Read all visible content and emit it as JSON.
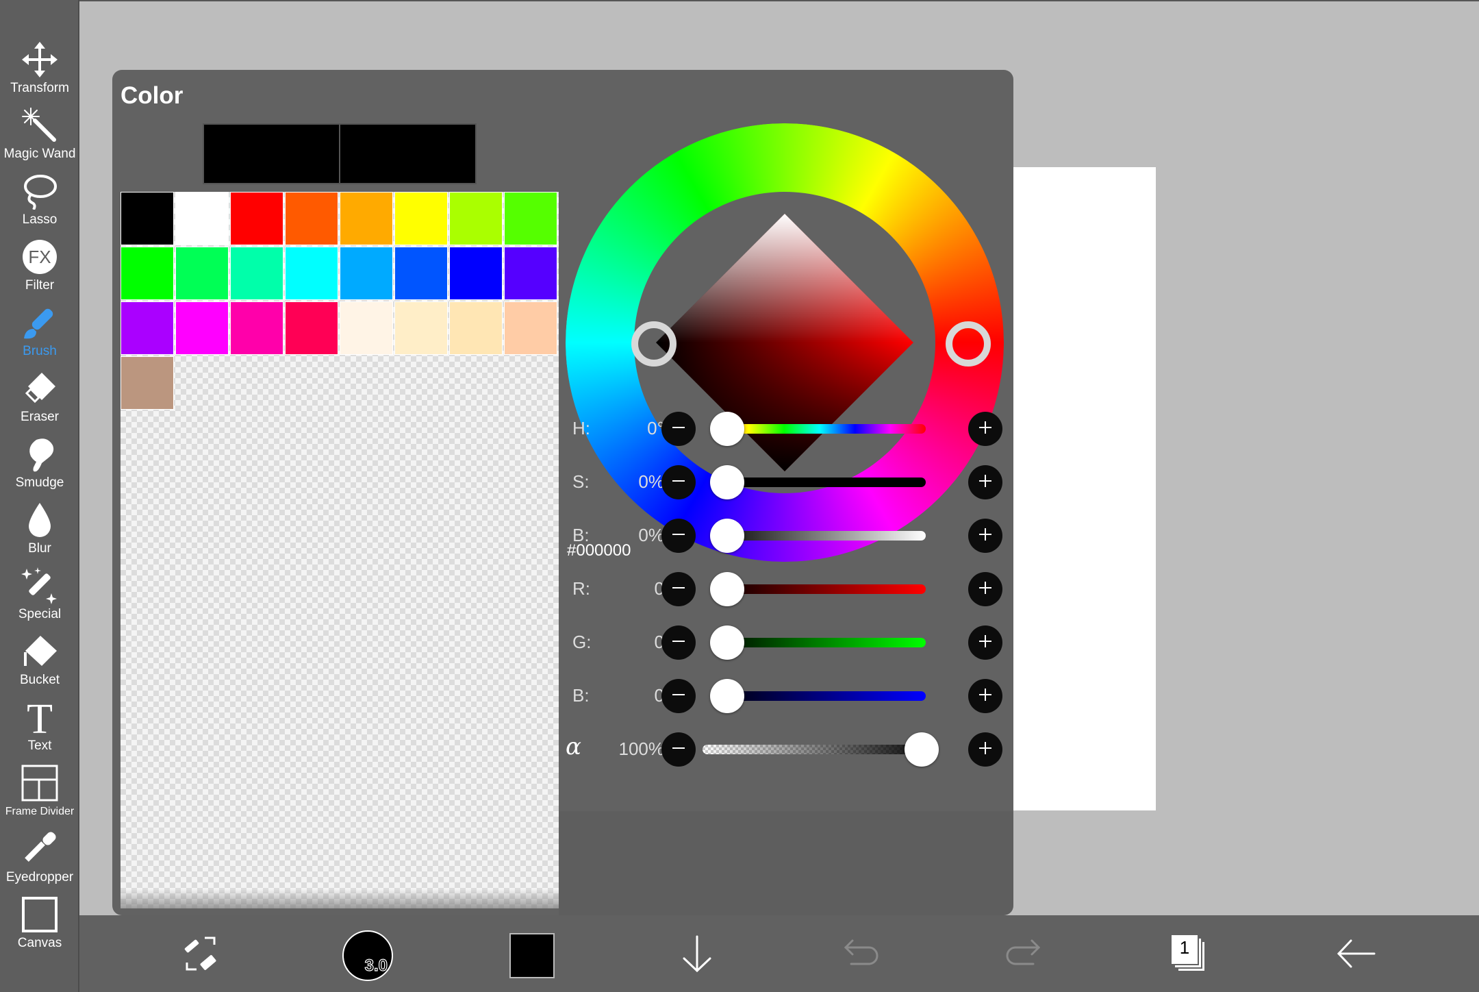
{
  "toolbar": {
    "items": [
      {
        "label": "Transform",
        "icon": "move-arrows-icon"
      },
      {
        "label": "Magic Wand",
        "icon": "magic-wand-icon"
      },
      {
        "label": "Lasso",
        "icon": "lasso-icon"
      },
      {
        "label": "Filter",
        "icon": "fx-icon"
      },
      {
        "label": "Brush",
        "icon": "brush-icon",
        "active": true
      },
      {
        "label": "Eraser",
        "icon": "eraser-icon"
      },
      {
        "label": "Smudge",
        "icon": "smudge-finger-icon"
      },
      {
        "label": "Blur",
        "icon": "droplet-icon"
      },
      {
        "label": "Special",
        "icon": "sparkle-pen-icon"
      },
      {
        "label": "Bucket",
        "icon": "bucket-icon"
      },
      {
        "label": "Text",
        "icon": "text-t-icon"
      },
      {
        "label": "Frame Divider",
        "icon": "frame-divider-icon"
      },
      {
        "label": "Eyedropper",
        "icon": "eyedropper-icon"
      },
      {
        "label": "Canvas",
        "icon": "canvas-square-icon"
      }
    ],
    "active_color": "#3b9af0"
  },
  "color_panel": {
    "title": "Color",
    "current_color": "#000000",
    "previous_color": "#000000",
    "hex": "#000000",
    "palette": [
      "#000000",
      "#ffffff",
      "#ff0000",
      "#ff5a00",
      "#ffaa00",
      "#ffff00",
      "#aaff00",
      "#55ff00",
      "#00ff00",
      "#00ff55",
      "#00ffaa",
      "#00ffff",
      "#00aaff",
      "#0055ff",
      "#0000ff",
      "#5500ff",
      "#aa00ff",
      "#ff00ff",
      "#ff00aa",
      "#ff0055",
      "#fff4e6",
      "#ffeec8",
      "#ffe6b4",
      "#ffcca6",
      "#bb967f"
    ],
    "sliders": [
      {
        "label": "H:",
        "value": "0°",
        "position": 0.0,
        "track": "hue"
      },
      {
        "label": "S:",
        "value": "0%",
        "position": 0.0,
        "track": "saturation"
      },
      {
        "label": "B:",
        "value": "0%",
        "position": 0.0,
        "track": "brightness"
      },
      {
        "label": "R:",
        "value": "0",
        "position": 0.0,
        "track": "red"
      },
      {
        "label": "G:",
        "value": "0",
        "position": 0.0,
        "track": "green"
      },
      {
        "label": "B:",
        "value": "0",
        "position": 0.0,
        "track": "blue"
      },
      {
        "label": "α",
        "value": "100%",
        "position": 1.0,
        "track": "alpha"
      }
    ]
  },
  "bottom_bar": {
    "brush_size": "3.0",
    "primary_color": "#000000",
    "layer_count": "1",
    "icons": [
      "swap-eraser-icon",
      "download-arrow-icon",
      "undo-icon",
      "redo-icon",
      "layers-icon",
      "back-arrow-icon"
    ]
  }
}
